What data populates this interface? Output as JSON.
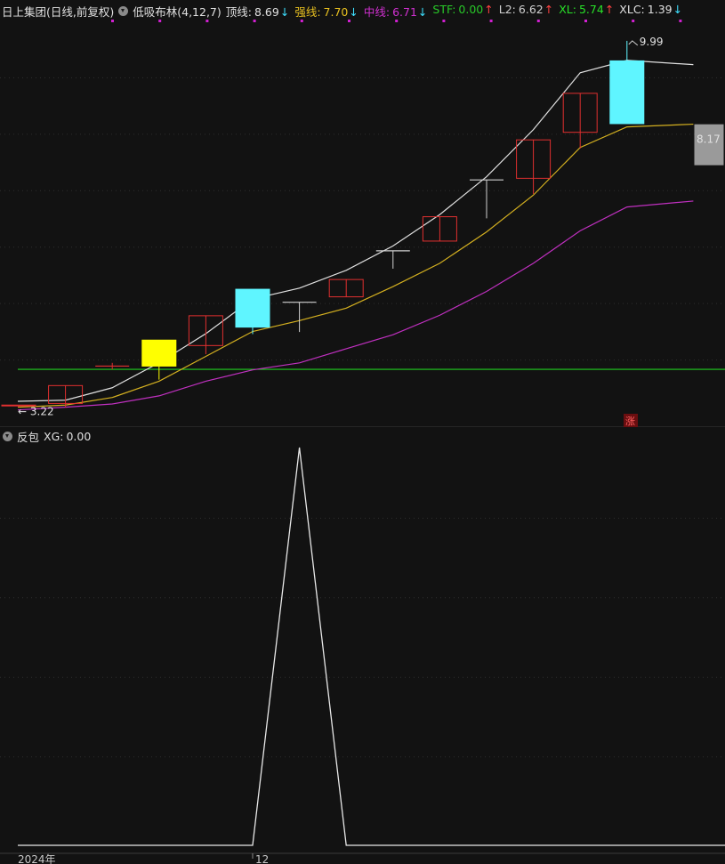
{
  "header": {
    "title": "日上集团",
    "period": "(日线,前复权)",
    "indicator": "低吸布林(4,12,7)",
    "items": [
      {
        "label": "顶线:",
        "value": "8.69",
        "arrow": "↓",
        "color": "#e0e0e0"
      },
      {
        "label": "强线:",
        "value": "7.70",
        "arrow": "↓",
        "color": "#e8c020"
      },
      {
        "label": "中线:",
        "value": "6.71",
        "arrow": "↓",
        "color": "#d030d0"
      },
      {
        "label": "STF:",
        "value": "0.00",
        "arrow": "↑",
        "color": "#28c828"
      },
      {
        "label": "L2:",
        "value": "6.62",
        "arrow": "↑",
        "color": "#d0d0d0"
      },
      {
        "label": "XL:",
        "value": "5.74",
        "arrow": "↑",
        "color": "#28e028"
      },
      {
        "label": "XLC:",
        "value": "1.39",
        "arrow": "↓",
        "color": "#e0e0e0"
      }
    ]
  },
  "subpanel": {
    "indicator": "反包",
    "label": "XG:",
    "value": "0.00"
  },
  "labels": {
    "high": "9.99",
    "low": "3.22",
    "last": "8.17",
    "zhang": "涨",
    "x_year": "2024年",
    "x_month": "12"
  },
  "colors": {
    "up": "#e03030",
    "down_cyan": "#5ff5ff",
    "yellow": "#ffff00",
    "gray": "#9a9a9a",
    "top_line": "#e0e0e0",
    "strong_line": "#d4b020",
    "mid_line": "#c030c0",
    "green_line": "#20d020",
    "xg_line": "#e8e8e8"
  },
  "chart_data": [
    {
      "type": "candlestick",
      "price_range": [
        3.05,
        10.35
      ],
      "candles": [
        {
          "o": 3.26,
          "h": 3.26,
          "l": 3.22,
          "c": 3.26,
          "style": "up"
        },
        {
          "o": 3.29,
          "h": 3.62,
          "l": 3.22,
          "c": 3.62,
          "style": "up"
        },
        {
          "o": 3.98,
          "h": 4.04,
          "l": 3.92,
          "c": 3.98,
          "style": "doji_red"
        },
        {
          "o": 3.98,
          "h": 4.46,
          "l": 3.73,
          "c": 4.46,
          "style": "yellow"
        },
        {
          "o": 4.36,
          "h": 4.91,
          "l": 4.2,
          "c": 4.91,
          "style": "up"
        },
        {
          "o": 5.4,
          "h": 5.4,
          "l": 4.57,
          "c": 4.7,
          "style": "cyan"
        },
        {
          "o": 5.16,
          "h": 5.16,
          "l": 4.61,
          "c": 5.16,
          "style": "doji_white"
        },
        {
          "o": 5.26,
          "h": 5.58,
          "l": 5.26,
          "c": 5.58,
          "style": "up"
        },
        {
          "o": 6.11,
          "h": 6.11,
          "l": 5.78,
          "c": 6.11,
          "style": "doji_white"
        },
        {
          "o": 6.29,
          "h": 6.74,
          "l": 6.29,
          "c": 6.74,
          "style": "up"
        },
        {
          "o": 7.42,
          "h": 7.42,
          "l": 6.71,
          "c": 7.42,
          "style": "doji_white"
        },
        {
          "o": 7.45,
          "h": 8.16,
          "l": 7.16,
          "c": 8.16,
          "style": "up"
        },
        {
          "o": 8.3,
          "h": 9.02,
          "l": 8.0,
          "c": 9.02,
          "style": "up"
        },
        {
          "o": 9.62,
          "h": 9.99,
          "l": 8.46,
          "c": 8.46,
          "style": "cyan"
        },
        {
          "o": 8.44,
          "h": 8.44,
          "l": 7.7,
          "c": 7.7,
          "style": "gray"
        }
      ],
      "top_line": [
        3.33,
        3.35,
        3.58,
        4.04,
        4.58,
        5.22,
        5.42,
        5.75,
        6.2,
        6.78,
        7.48,
        8.35,
        9.4,
        9.63,
        9.55
      ],
      "strong_line": [
        3.22,
        3.26,
        3.4,
        3.7,
        4.16,
        4.62,
        4.82,
        5.05,
        5.45,
        5.88,
        6.46,
        7.14,
        8.02,
        8.4,
        8.45
      ],
      "mid_line": [
        3.17,
        3.22,
        3.28,
        3.43,
        3.7,
        3.91,
        4.04,
        4.3,
        4.56,
        4.92,
        5.36,
        5.88,
        6.48,
        6.92,
        7.03
      ],
      "green_level": 3.92,
      "annotations": [
        {
          "text": "9.99",
          "candle": 13,
          "value": 9.99
        },
        {
          "text": "3.22",
          "candle": 0,
          "value": 3.22
        },
        {
          "text": "8.17",
          "candle": 14,
          "value": 8.17
        }
      ]
    },
    {
      "type": "line",
      "name": "XG",
      "y_range": [
        0,
        1
      ],
      "x": [
        0,
        1,
        2,
        3,
        4,
        5,
        6,
        7,
        8,
        9,
        10,
        11,
        12,
        13,
        14
      ],
      "values": [
        0,
        0,
        0,
        0,
        0,
        0,
        1,
        0,
        0,
        0,
        0,
        0,
        0,
        0,
        0
      ],
      "x_tick_labels": [
        "2024年",
        "12"
      ]
    }
  ]
}
